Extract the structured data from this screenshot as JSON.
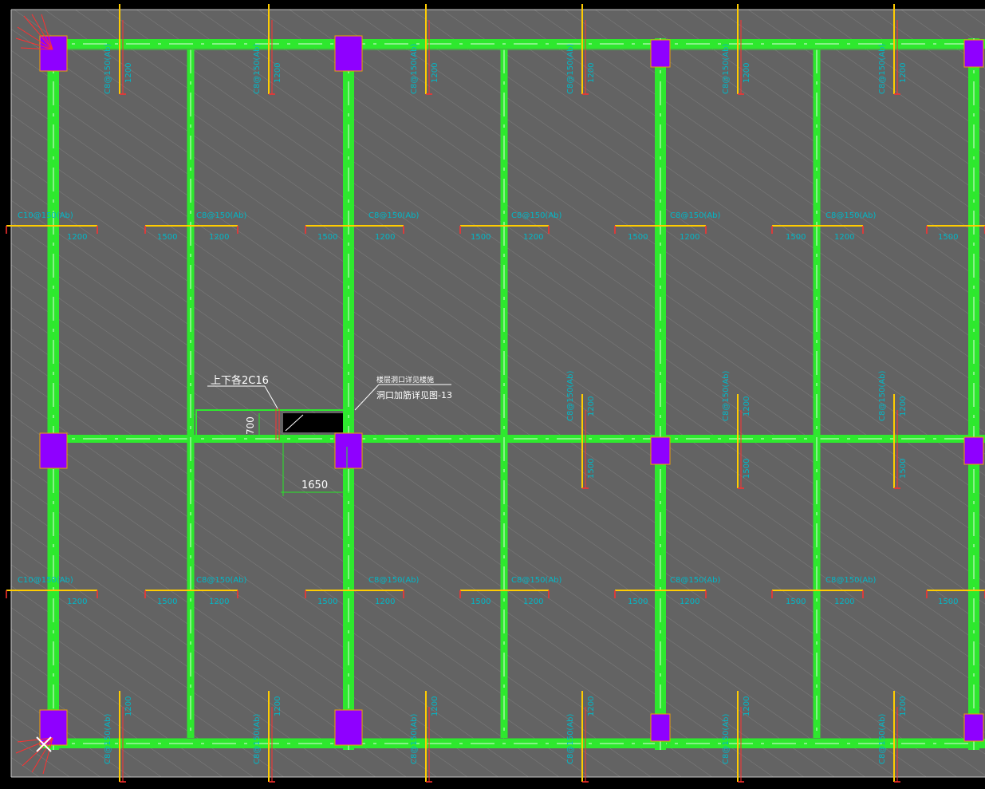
{
  "colors": {
    "background": "#000000",
    "slab_fill": "#636363",
    "hatch": "#8a8a8a",
    "beam": "#2ee82e",
    "beam_center": "#ffffff",
    "column": "#8f00ff",
    "column_border": "#f0a000",
    "rebar": "#ffcc00",
    "rebar_end": "#ff3030",
    "label_cyan": "#00b8c8",
    "annotation": "#ffffff",
    "dimension": "#27e827",
    "opening": "#000000",
    "border_line": "#c8c8c8"
  },
  "annotations": {
    "rebar_note": "上下各2C16",
    "opening_note_line1": "楼层洞口详见楼施",
    "opening_note_line2": "洞口加筋详见图-13",
    "dim_height": "700",
    "dim_width": "1650"
  },
  "rebar_labels": {
    "top_left": "C10@150(Ab)",
    "mid": "C8@150(Ab)",
    "length_a": "1200",
    "length_b": "1500"
  },
  "icons": {
    "ucs": "ucs-cross-icon"
  }
}
